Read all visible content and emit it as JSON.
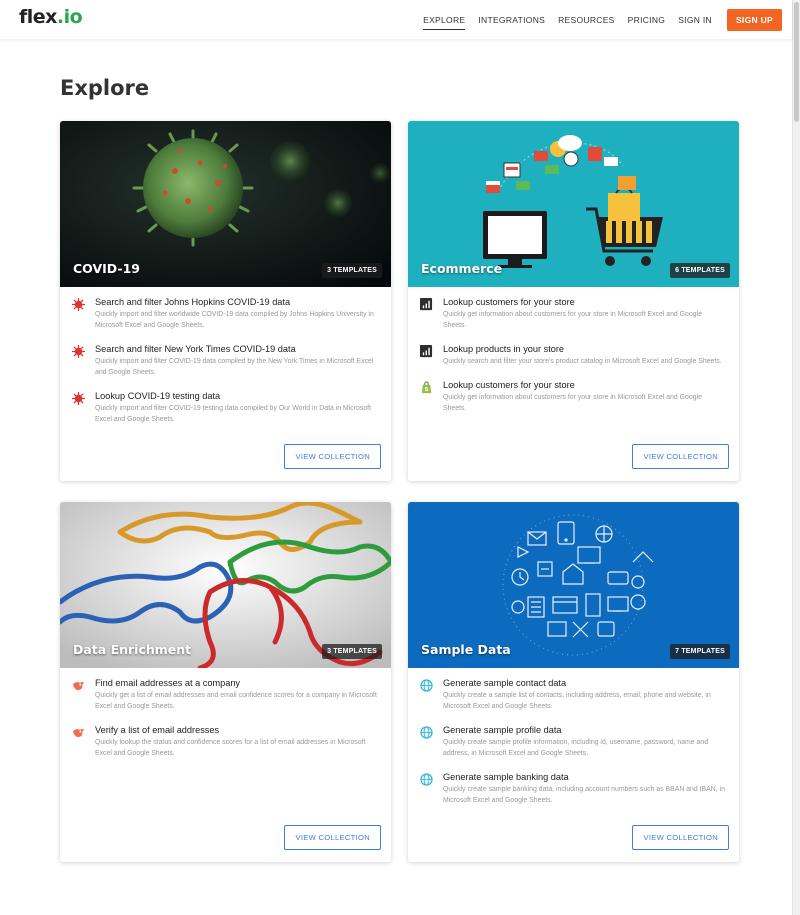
{
  "header": {
    "logo_main": "flex",
    "logo_accent": ".io",
    "nav": [
      "EXPLORE",
      "INTEGRATIONS",
      "RESOURCES",
      "PRICING",
      "SIGN IN"
    ],
    "signup": "SIGN UP"
  },
  "page_title": "Explore",
  "cards": [
    {
      "title": "COVID-19",
      "badge": "3 TEMPLATES",
      "button": "VIEW COLLECTION",
      "items": [
        {
          "title": "Search and filter Johns Hopkins COVID-19 data",
          "desc": "Quickly import and filter worldwide COVID-19 data compiled by Johns Hopkins University in Microsoft Excel and Google Sheets."
        },
        {
          "title": "Search and filter New York Times COVID-19 data",
          "desc": "Quickly import and filter COVID-19 data compiled by the New York Times in Microsoft Excel and Google Sheets."
        },
        {
          "title": "Lookup COVID-19 testing data",
          "desc": "Quickly import and filter COVID-19 testing data compiled by Our World in Data in Microsoft Excel and Google Sheets."
        }
      ]
    },
    {
      "title": "Ecommerce",
      "badge": "6 TEMPLATES",
      "button": "VIEW COLLECTION",
      "items": [
        {
          "title": "Lookup customers for your store",
          "desc": "Quickly get information about customers for your store in Microsoft Excel and Google Sheets."
        },
        {
          "title": "Lookup products in your store",
          "desc": "Quickly search and filter your store's product catalog in Microsoft Excel and Google Sheets."
        },
        {
          "title": "Lookup customers for your store",
          "desc": "Quickly get information about customers for your store in Microsoft Excel and Google Sheets."
        }
      ]
    },
    {
      "title": "Data Enrichment",
      "badge": "3 TEMPLATES",
      "button": "VIEW COLLECTION",
      "items": [
        {
          "title": "Find email addresses at a company",
          "desc": "Quickly get a list of email addresses and email confidence scores for a company in Microsoft Excel and Google Sheets."
        },
        {
          "title": "Verify a list of email addresses",
          "desc": "Quickly lookup the status and confidence scores for a list of email addresses in Microsoft Excel and Google Sheets."
        }
      ]
    },
    {
      "title": "Sample Data",
      "badge": "7 TEMPLATES",
      "button": "VIEW COLLECTION",
      "items": [
        {
          "title": "Generate sample contact data",
          "desc": "Quickly create a sample list of contacts, including address, email, phone and website, in Microsoft Excel and Google Sheets."
        },
        {
          "title": "Generate sample profile data",
          "desc": "Quickly create sample profile information, including id, username, password, name and address, in Microsoft Excel and Google Sheets."
        },
        {
          "title": "Generate sample banking data",
          "desc": "Quickly create sample banking data, including account numbers such as BBAN and IBAN, in Microsoft Excel and Google Sheets."
        }
      ]
    }
  ],
  "icons": {
    "covid": "virus-icon",
    "ecommerce": [
      "chart-icon",
      "chart-icon",
      "shopify-icon"
    ],
    "enrichment": "hunter-icon",
    "sample": "globe-icon"
  },
  "colors": {
    "accent": "#f26522",
    "link": "#3f7ed6",
    "logo_accent": "#2aa84a",
    "ecommerce_bg": "#1fb0bf",
    "sample_bg": "#0d6bbf",
    "virus_red": "#d33"
  }
}
